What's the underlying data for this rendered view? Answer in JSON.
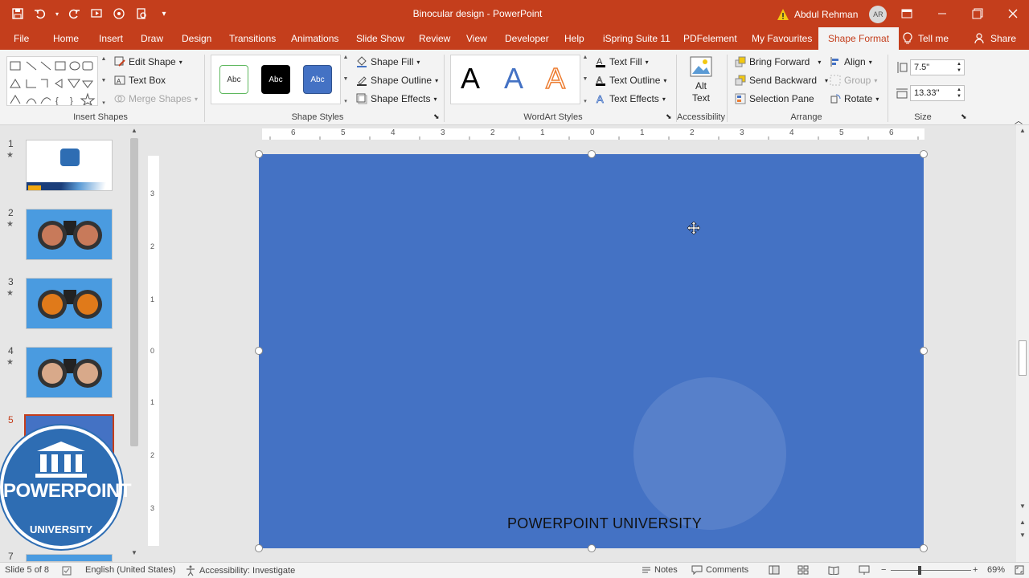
{
  "app": {
    "doc_title": "Binocular design  -  PowerPoint",
    "user_name": "Abdul Rehman",
    "user_initials": "AR"
  },
  "tabs": [
    {
      "label": "File"
    },
    {
      "label": "Home"
    },
    {
      "label": "Insert"
    },
    {
      "label": "Draw"
    },
    {
      "label": "Design"
    },
    {
      "label": "Transitions"
    },
    {
      "label": "Animations"
    },
    {
      "label": "Slide Show"
    },
    {
      "label": "Review"
    },
    {
      "label": "View"
    },
    {
      "label": "Developer"
    },
    {
      "label": "Help"
    },
    {
      "label": "iSpring Suite 11"
    },
    {
      "label": "PDFelement"
    },
    {
      "label": "My Favourites"
    },
    {
      "label": "Shape Format"
    }
  ],
  "tell_me": "Tell me",
  "share": "Share",
  "ribbon": {
    "insert_shapes": {
      "label": "Insert Shapes",
      "edit_shape": "Edit Shape",
      "text_box": "Text Box",
      "merge_shapes": "Merge Shapes"
    },
    "shape_styles": {
      "label": "Shape Styles",
      "swatch": "Abc",
      "shape_fill": "Shape Fill",
      "shape_outline": "Shape Outline",
      "shape_effects": "Shape Effects"
    },
    "wordart": {
      "label": "WordArt Styles",
      "letter": "A",
      "text_fill": "Text Fill",
      "text_outline": "Text Outline",
      "text_effects": "Text Effects"
    },
    "accessibility": {
      "label": "Accessibility",
      "alt_line1": "Alt",
      "alt_line2": "Text"
    },
    "arrange": {
      "label": "Arrange",
      "bring_forward": "Bring Forward",
      "send_backward": "Send Backward",
      "selection_pane": "Selection Pane",
      "align": "Align",
      "group": "Group",
      "rotate": "Rotate"
    },
    "size": {
      "label": "Size",
      "height": "7.5\"",
      "width": "13.33\""
    }
  },
  "slides": [
    {
      "num": "1",
      "star": "★"
    },
    {
      "num": "2",
      "star": "★"
    },
    {
      "num": "3",
      "star": "★"
    },
    {
      "num": "4",
      "star": "★"
    },
    {
      "num": "5"
    },
    {
      "num": "7"
    }
  ],
  "ruler": {
    "h_ticks": [
      "6",
      "5",
      "4",
      "3",
      "2",
      "1",
      "0",
      "1",
      "2",
      "3",
      "4",
      "5",
      "6"
    ],
    "v_ticks": [
      "3",
      "2",
      "1",
      "0",
      "1",
      "2",
      "3"
    ]
  },
  "slide": {
    "footer_text": "POWERPOINT UNIVERSITY"
  },
  "logo": {
    "title": "POWERPOINT",
    "sub": "UNIVERSITY"
  },
  "status": {
    "slide_info": "Slide 5 of 8",
    "language": "English (United States)",
    "accessibility": "Accessibility: Investigate",
    "notes": "Notes",
    "comments": "Comments",
    "zoom": "69%"
  },
  "colors": {
    "accent": "#c43e1c",
    "slide_fill": "#4472c4"
  }
}
